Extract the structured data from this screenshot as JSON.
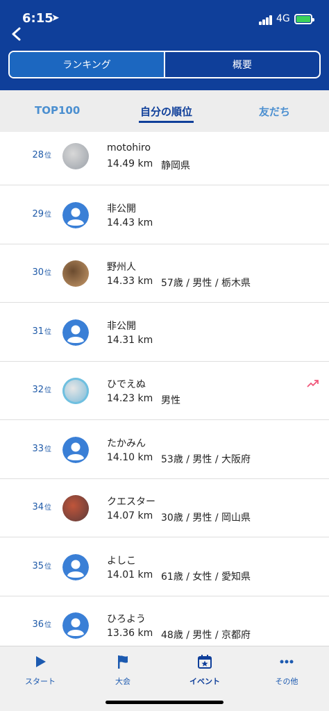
{
  "status_bar": {
    "time": "6:15",
    "network": "4G"
  },
  "segment": {
    "tabs": [
      {
        "label": "ランキング"
      },
      {
        "label": "概要"
      }
    ]
  },
  "subtabs": [
    {
      "label": "TOP100"
    },
    {
      "label": "自分の順位"
    },
    {
      "label": "友だち"
    }
  ],
  "rank_suffix": "位",
  "rows": [
    {
      "rank": "28",
      "name": "motohiro",
      "distance": "14.49 km",
      "meta": "静岡県",
      "avatar": "photo"
    },
    {
      "rank": "29",
      "name": "非公開",
      "distance": "14.43 km",
      "meta": "",
      "avatar": "default"
    },
    {
      "rank": "30",
      "name": "野州人",
      "distance": "14.33 km",
      "meta": "57歳 / 男性 / 栃木県",
      "avatar": "photo"
    },
    {
      "rank": "31",
      "name": "非公開",
      "distance": "14.31 km",
      "meta": "",
      "avatar": "default"
    },
    {
      "rank": "32",
      "name": "ひでえぬ",
      "distance": "14.23 km",
      "meta": "男性",
      "avatar": "photo",
      "trend": true
    },
    {
      "rank": "33",
      "name": "たかみん",
      "distance": "14.10 km",
      "meta": "53歳 / 男性 / 大阪府",
      "avatar": "default"
    },
    {
      "rank": "34",
      "name": "クエスター",
      "distance": "14.07 km",
      "meta": "30歳 / 男性 / 岡山県",
      "avatar": "photo"
    },
    {
      "rank": "35",
      "name": "よしこ",
      "distance": "14.01 km",
      "meta": "61歳 / 女性 / 愛知県",
      "avatar": "default"
    },
    {
      "rank": "36",
      "name": "ひろよう",
      "distance": "13.36 km",
      "meta": "48歳 / 男性 / 京都府",
      "avatar": "default"
    }
  ],
  "tabbar": [
    {
      "label": "スタート",
      "icon": "play-icon"
    },
    {
      "label": "大会",
      "icon": "flag-icon"
    },
    {
      "label": "イベント",
      "icon": "calendar-star-icon"
    },
    {
      "label": "その他",
      "icon": "more-icon"
    }
  ],
  "colors": {
    "header": "#0f3f9a",
    "accent": "#1c67c0",
    "avatar_default": "#3a7fd6",
    "trend": "#f0577a"
  }
}
